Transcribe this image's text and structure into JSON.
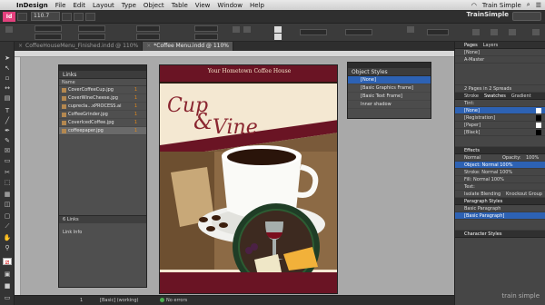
{
  "menubar": {
    "app": "InDesign",
    "items": [
      "File",
      "Edit",
      "Layout",
      "Type",
      "Object",
      "Table",
      "View",
      "Window",
      "Help"
    ],
    "workspace": "Train Simple"
  },
  "appbar": {
    "zoom": "110.7",
    "workspace_label": "TrainSimple"
  },
  "tabs": [
    {
      "label": "CoffeeHouseMenu_Finished.indd @ 110%"
    },
    {
      "label": "*Coffee Menu.indd @ 110%"
    }
  ],
  "page": {
    "header_text": "Your Hometown Coffee House",
    "cup": "Cup",
    "amp": "&",
    "vine": "Vine"
  },
  "links_panel": {
    "tab": "Links",
    "column_name": "Name",
    "items": [
      {
        "name": "CoverCoffeeCup.jpg",
        "page": "1"
      },
      {
        "name": "CoverWineCheese.jpg",
        "page": "1"
      },
      {
        "name": "cuprecla...xPROCESS.ai",
        "page": "1"
      },
      {
        "name": "CoffeeGrinder.jpg",
        "page": "1"
      },
      {
        "name": "CoverIcedCoffee.jpg",
        "page": "1"
      },
      {
        "name": "coffeepaper.jpg",
        "page": "1"
      }
    ],
    "count": "6 Links",
    "info_label": "Link Info"
  },
  "object_styles_panel": {
    "tab": "Object Styles",
    "items": [
      "[None]",
      "[Basic Graphics Frame]",
      "[Basic Text Frame]",
      "Inner shadow"
    ]
  },
  "dock": {
    "pages": {
      "tabs": [
        "Pages",
        "Layers"
      ],
      "rows": [
        "[None]",
        "A-Master"
      ],
      "summary": "2 Pages in 2 Spreads"
    },
    "swatches": {
      "tabs": [
        "Stroke",
        "Swatches",
        "Gradient"
      ],
      "tint_label": "Tint:",
      "rows": [
        {
          "name": "[None]",
          "color": "#ffffff"
        },
        {
          "name": "[Registration]",
          "color": "#000000"
        },
        {
          "name": "[Paper]",
          "color": "#ffffff"
        },
        {
          "name": "[Black]",
          "color": "#000000"
        }
      ]
    },
    "effects": {
      "tab": "Effects",
      "mode": "Normal",
      "opacity_label": "Opacity:",
      "opacity": "100%",
      "object_row": "Object: Normal 100%",
      "rows": [
        "Stroke: Normal 100%",
        "Fill: Normal 100%",
        "Text:"
      ],
      "isolate": "Isolate Blending",
      "knockout": "Knockout Group"
    },
    "paragraph_styles": {
      "tab": "Paragraph Styles",
      "current": "Basic Paragraph",
      "rows": [
        "[Basic Paragraph]"
      ]
    },
    "character_styles": {
      "tab": "Character Styles"
    }
  },
  "status": {
    "page": "1",
    "state": "[Basic] (working)",
    "errors": "No errors"
  },
  "watermark": "train simple"
}
